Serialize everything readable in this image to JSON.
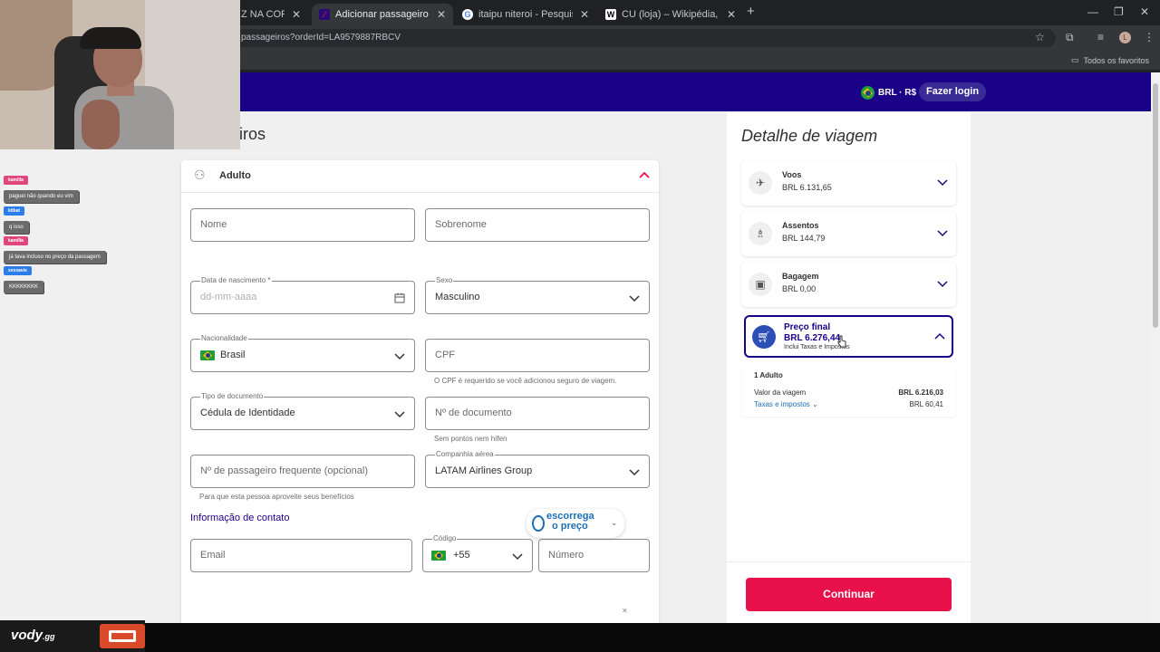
{
  "browser": {
    "tabs": [
      {
        "title": "Z NA COREIA D",
        "active": false
      },
      {
        "title": "Adicionar passageiro | LATAM A",
        "active": true
      },
      {
        "title": "itaipu niteroi - Pesquisa Google",
        "active": false
      },
      {
        "title": "CU (loja) – Wikipédia, a enciclop",
        "active": false
      }
    ],
    "new_tab": "+",
    "url": "passageiros?orderId=LA9579887RBCV",
    "bookmarks_label": "Todos os favoritos",
    "profile_initial": "L",
    "window_controls": {
      "minimize": "—",
      "restore": "❐",
      "close": "✕"
    }
  },
  "header": {
    "currency": "BRL · R$",
    "login": "Fazer login"
  },
  "page_title": "iros",
  "form": {
    "section": "Adulto",
    "fields": {
      "nome": "Nome",
      "sobrenome": "Sobrenome",
      "birth_label": "Data de nascimento *",
      "birth_placeholder": "dd-mm-aaaa",
      "sexo_label": "Sexo",
      "sexo_value": "Masculino",
      "nacionalidade_label": "Nacionalidade",
      "nacionalidade_value": "Brasil",
      "cpf": "CPF",
      "cpf_help": "O CPF é requerido se você adicionou seguro de viagem.",
      "tipo_doc_label": "Tipo de documento",
      "tipo_doc_value": "Cédula de Identidade",
      "num_doc": "Nº de documento",
      "num_doc_help": "Sem pontos nem hífen",
      "frequent": "Nº de passageiro frequente (opcional)",
      "frequent_help": "Para que esta pessoa aproveite seus benefícios",
      "airline_label": "Companhia aérea",
      "airline_value": "LATAM Airlines Group"
    },
    "contact_title": "Informação de contato",
    "contact": {
      "email": "Email",
      "code_label": "Código",
      "code_value": "+55",
      "numero": "Número"
    }
  },
  "escorrega": {
    "line1": "escorrega",
    "line2": "o preço"
  },
  "sidebar": {
    "title": "Detalhe de viagem",
    "items": [
      {
        "name": "Voos",
        "price": "BRL 6.131,65",
        "icon": "plane-icon"
      },
      {
        "name": "Assentos",
        "price": "BRL 144,79",
        "icon": "seat-icon"
      },
      {
        "name": "Bagagem",
        "price": "BRL 0,00",
        "icon": "luggage-icon"
      }
    ],
    "final": {
      "name": "Preço final",
      "price": "BRL 6.276,44",
      "note": "Inclui Taxas e Impostos"
    },
    "breakdown": {
      "head": "1 Adulto",
      "trip_label": "Valor da viagem",
      "trip_value": "BRL 6.216,03",
      "tax_label": "Taxas e impostos",
      "tax_value": "BRL 60,41"
    },
    "continue": "Continuar"
  },
  "chat": [
    {
      "user": "kamilla",
      "msg": "paguei não quando eu vim",
      "color": "#e0457b"
    },
    {
      "user": "kitkat",
      "msg": "q isso",
      "color": "#2b7de9"
    },
    {
      "user": "kamilla",
      "msg": "já tava incluso no preço da passagem",
      "color": "#e0457b"
    },
    {
      "user": "xxxxavie",
      "msg": "KKKKKKKK",
      "color": "#2b7de9"
    }
  ],
  "overlay": {
    "brand": "vody",
    "brand_suffix": ".gg"
  }
}
